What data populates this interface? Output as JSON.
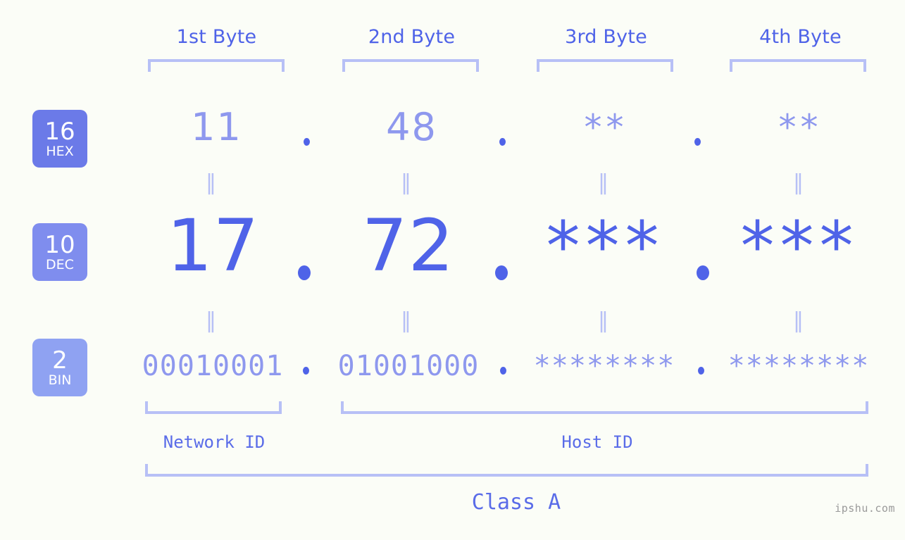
{
  "background_color": "#fbfdf7",
  "accent_color": "#4f63e8",
  "accent_light_color": "#8e98ee",
  "bracket_color": "#b7c0f6",
  "byte_headers": [
    {
      "label": "1st Byte"
    },
    {
      "label": "2nd Byte"
    },
    {
      "label": "3rd Byte"
    },
    {
      "label": "4th Byte"
    }
  ],
  "rows": [
    {
      "badge_number": "16",
      "badge_name": "HEX",
      "badge_color": "#6b7ae8",
      "values": [
        "11",
        "48",
        "**",
        "**"
      ],
      "separator": "."
    },
    {
      "badge_number": "10",
      "badge_name": "DEC",
      "badge_color": "#7f8dee",
      "values": [
        "17",
        "72",
        "***",
        "***"
      ],
      "separator": "."
    },
    {
      "badge_number": "2",
      "badge_name": "BIN",
      "badge_color": "#8fa2f2",
      "values": [
        "00010001",
        "01001000",
        "********",
        "********"
      ],
      "separator": "."
    }
  ],
  "equality_mark": "‖",
  "captions": {
    "network_id": "Network ID",
    "host_id": "Host ID",
    "class": "Class A"
  },
  "watermark": "ipshu.com"
}
